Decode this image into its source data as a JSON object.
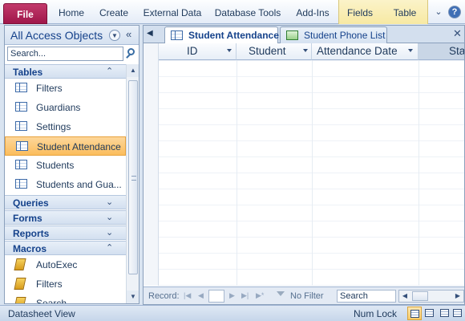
{
  "ribbon": {
    "file": "File",
    "tabs": [
      "Home",
      "Create",
      "External Data",
      "Database Tools",
      "Add-Ins"
    ],
    "context_tabs": [
      "Fields",
      "Table"
    ]
  },
  "nav": {
    "title": "All Access Objects",
    "search_placeholder": "Search...",
    "groups": {
      "tables": {
        "label": "Tables",
        "items": [
          "Filters",
          "Guardians",
          "Settings",
          "Student Attendance",
          "Students",
          "Students and Gua..."
        ]
      },
      "queries": {
        "label": "Queries"
      },
      "forms": {
        "label": "Forms"
      },
      "reports": {
        "label": "Reports"
      },
      "macros": {
        "label": "Macros",
        "items": [
          "AutoExec",
          "Filters",
          "Search"
        ]
      }
    },
    "selected_item": "Student Attendance"
  },
  "doc": {
    "tabs": [
      "Student Attendance",
      "Student Phone List"
    ],
    "active_tab": "Student Attendance",
    "columns": [
      "ID",
      "Student",
      "Attendance Date",
      "Sta"
    ]
  },
  "recnav": {
    "record_label": "Record:",
    "no_filter": "No Filter",
    "search": "Search"
  },
  "status": {
    "view": "Datasheet View",
    "num_lock": "Num Lock"
  },
  "icons": {
    "table": "table-icon",
    "macro": "macro-icon",
    "form": "form-icon",
    "search": "search-icon"
  },
  "colors": {
    "file_tab": "#a0174a",
    "selection": "#fbbd5d",
    "context_group": "#f7e9a3",
    "chrome": "#d9e4f1"
  }
}
